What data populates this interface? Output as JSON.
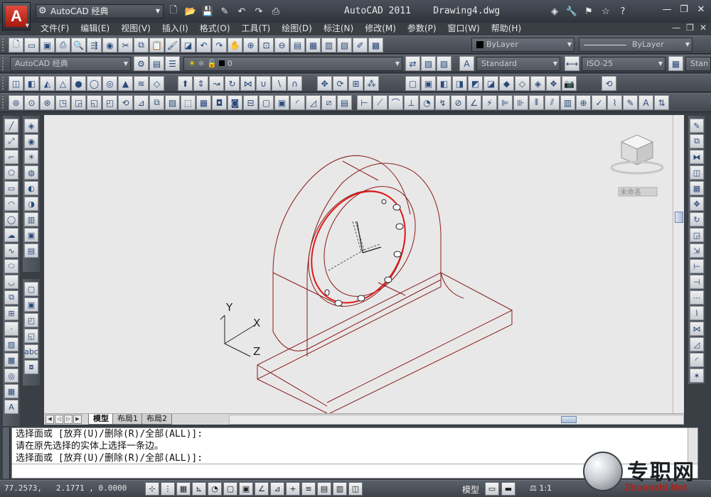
{
  "titlebar": {
    "workspace": "AutoCAD 经典",
    "app_name": "AutoCAD 2011",
    "doc_name": "Drawing4.dwg"
  },
  "menu": [
    "文件(F)",
    "编辑(E)",
    "视图(V)",
    "插入(I)",
    "格式(O)",
    "工具(T)",
    "绘图(D)",
    "标注(N)",
    "修改(M)",
    "参数(P)",
    "窗口(W)",
    "帮助(H)"
  ],
  "toolbar": {
    "layer_color": "ByLayer",
    "linetype": "ByLayer",
    "workspace_combo": "AutoCAD 经典",
    "layer_combo": "0",
    "text_style": "Standard",
    "dim_style": "ISO-25",
    "table_style": "Stan"
  },
  "viewcube": {
    "ucs_label": "未命名"
  },
  "ucs": {
    "x": "X",
    "y": "Y",
    "z": "Z"
  },
  "tabs": [
    "模型",
    "布局1",
    "布局2"
  ],
  "command": {
    "lines": [
      "选择面或 [放弃(U)/删除(R)/全部(ALL)]:",
      "请在原先选择的实体上选择一条边。",
      "选择面或 [放弃(U)/删除(R)/全部(ALL)]:"
    ]
  },
  "status": {
    "coords": "77.2573,   2.1771 , 0.0000",
    "model": "模型",
    "scale": "1:1"
  },
  "watermark": {
    "text": "专职网",
    "sub": "Zhuanzhi.Net"
  },
  "colors": {
    "drawing_line": "#8b1a1a",
    "selection": "#e01818",
    "viewport_bg": "#e8e8e8"
  }
}
